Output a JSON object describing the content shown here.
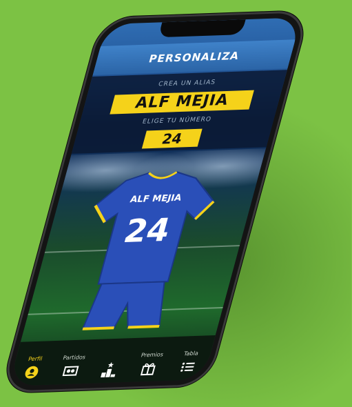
{
  "app": {
    "header_title": "PERSONALIZA",
    "alias_label": "CREA UN ALIAS",
    "alias_value": "ALF MEJIA",
    "number_label": "ELIGE TU NÚMERO",
    "number_value": "24",
    "jersey_name": "ALF MEJIA",
    "jersey_number": "24"
  },
  "nav": {
    "items": [
      {
        "label": "Perfil",
        "icon": "profile-icon",
        "active": true
      },
      {
        "label": "Partidos",
        "icon": "matches-icon",
        "active": false
      },
      {
        "label": "",
        "icon": "podium-icon",
        "active": false
      },
      {
        "label": "Premios",
        "icon": "gift-icon",
        "active": false
      },
      {
        "label": "Tabla",
        "icon": "list-icon",
        "active": false
      }
    ]
  },
  "colors": {
    "background": "#7cc244",
    "accent_yellow": "#f5d21a",
    "jersey_blue": "#2a4fb8",
    "header_blue": "#3f82c9"
  }
}
